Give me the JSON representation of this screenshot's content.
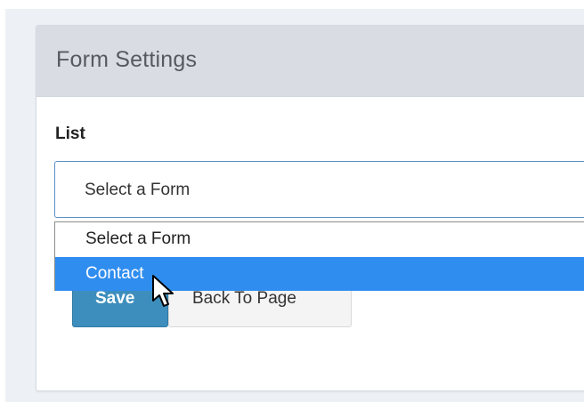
{
  "form_settings": {
    "title": "Form Settings",
    "list_label": "List",
    "select": {
      "selected_value": "Select a Form",
      "options": [
        "Select a Form",
        "Contact"
      ],
      "highlighted_option": "Contact"
    },
    "buttons": {
      "save_label": "Save",
      "back_label": "Back To Page"
    }
  },
  "colors": {
    "header_bg": "#d9dde3",
    "save_button": "#3d8ebd",
    "option_highlight": "#2f8df0",
    "select_border": "#5b8fc7"
  },
  "icons": {
    "cursor": "mouse-pointer-icon"
  }
}
